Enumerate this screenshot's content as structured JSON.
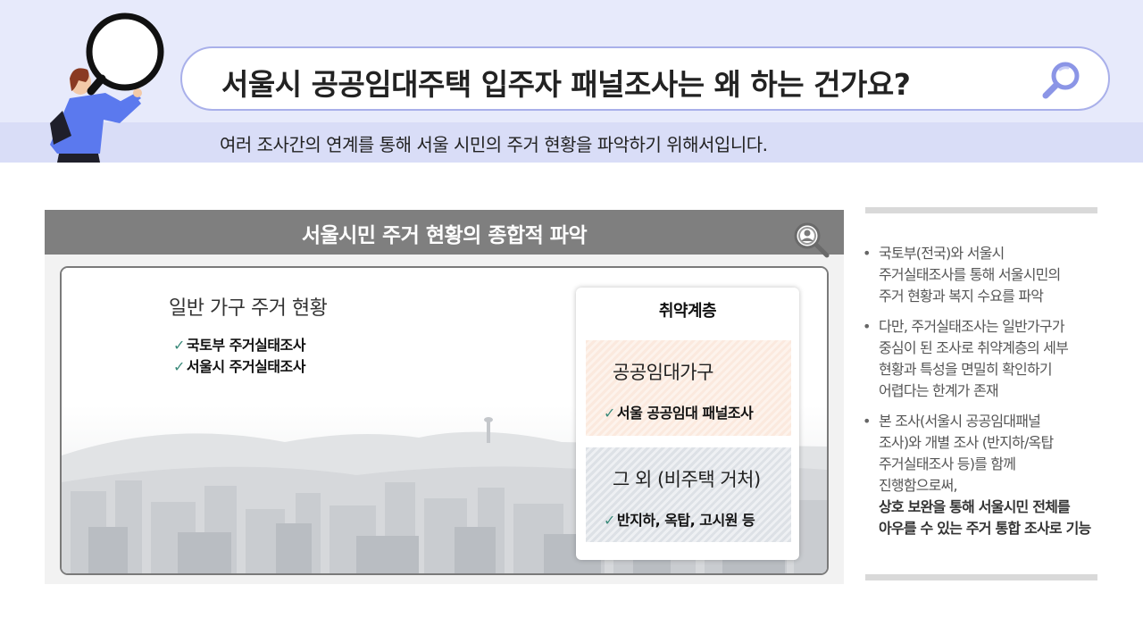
{
  "header": {
    "question": "서울시 공공임대주택 입주자 패널조사는 왜 하는 건가요?",
    "answer": "여러 조사간의 연계를 통해 서울 시민의 주거 현황을 파악하기 위해서입니다."
  },
  "panel": {
    "title": "서울시민 주거 현황의 종합적 파악",
    "general": {
      "title": "일반 가구 주거 현황",
      "items": [
        "국토부 주거실태조사",
        "서울시 주거실태조사"
      ]
    },
    "vulnerable": {
      "title": "취약계층",
      "groups": [
        {
          "title": "공공임대가구",
          "item": "서울 공공임대 패널조사"
        },
        {
          "title": "그 외 (비주택 거처)",
          "item": "반지하, 옥탑, 고시원 등"
        }
      ]
    }
  },
  "notes": {
    "b1": [
      "국토부(전국)와 서울시",
      "주거실태조사를 통해 서울시민의",
      "주거 현황과 복지 수요를 파악"
    ],
    "b2": [
      "다만, 주거실태조사는 일반가구가",
      "중심이 된 조사로 취약계층의 세부",
      "현황과 특성을 면밀히 확인하기",
      "어렵다는 한계가 존재"
    ],
    "b3": [
      "본 조사(서울시 공공임대패널",
      "조사)와 개별 조사 (반지하/옥탑",
      "주거실태조사 등)를 함께",
      "진행함으로써,"
    ],
    "b3_em": [
      "상호 보완을 통해 서울시민 전체를",
      "아우를 수 있는 주거 통합 조사로 기능"
    ]
  },
  "check_mark": "✓",
  "colors": {
    "header_bg": "#e7eafb",
    "header_band": "#d9ddf7",
    "search_border": "#a9b0ea",
    "search_icon": "#8b95e6",
    "panel_title_bg": "#7f7f7f",
    "check": "#3b8a7a"
  },
  "icons": [
    "magnifying-glass-person-illustration",
    "search-icon",
    "magnifier-person-icon"
  ]
}
